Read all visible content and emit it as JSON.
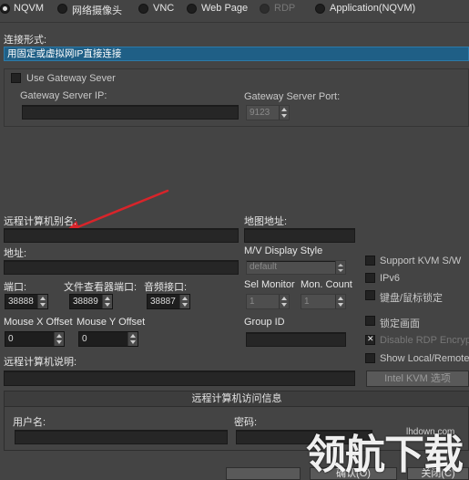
{
  "connection_types": [
    {
      "label": "NQVM",
      "selected": true
    },
    {
      "label": "网络摄像头",
      "selected": false
    },
    {
      "label": "VNC",
      "selected": false
    },
    {
      "label": "Web Page",
      "selected": false
    },
    {
      "label": "RDP",
      "selected": false
    },
    {
      "label": "Application(NQVM)",
      "selected": false
    }
  ],
  "connection_form": {
    "label": "连接形式:",
    "value": "用固定或虚拟网IP直接连接"
  },
  "gateway": {
    "use_label": "Use Gateway Sever",
    "ip_label": "Gateway Server IP:",
    "ip_value": "",
    "port_label": "Gateway Server Port:",
    "port_value": "9123"
  },
  "remote": {
    "alias_label": "远程计算机别名:",
    "alias_value": "",
    "map_label": "地图地址:",
    "map_value": "",
    "address_label": "地址:",
    "address_value": "",
    "mv_style_label": "M/V Display Style",
    "mv_style_value": "default",
    "port_label": "端口:",
    "port_value": "38888",
    "fileviewer_port_label": "文件查看器端口:",
    "fileviewer_port_value": "38889",
    "audio_port_label": "音频接口:",
    "audio_port_value": "38887",
    "sel_monitor_label": "Sel Monitor",
    "sel_monitor_value": "1",
    "mon_count_label": "Mon. Count",
    "mon_count_value": "1",
    "mouse_x_label": "Mouse X Offset",
    "mouse_x_value": "0",
    "mouse_y_label": "Mouse Y Offset",
    "mouse_y_value": "0",
    "group_id_label": "Group ID",
    "group_id_value": "",
    "desc_label": "远程计算机说明:",
    "desc_value": ""
  },
  "options": {
    "support_kvm": "Support KVM S/W",
    "ipv6": "IPv6",
    "lock_kb_mouse": "键盘/鼠标锁定",
    "lock_screen": "锁定画面",
    "disable_rdp": "Disable RDP Encryption",
    "show_local_remote": "Show Local/Remote Info",
    "intel_kvm_button": "Intel KVM 选项"
  },
  "access_info": {
    "title": "远程计算机访问信息",
    "username_label": "用户名:",
    "username_value": "",
    "password_label": "密码:",
    "password_value": ""
  },
  "footer": {
    "ok": "确认(O)",
    "close": "关闭(C)"
  },
  "watermark": {
    "site": "lhdown.com",
    "brand": "领航下载"
  },
  "colors": {
    "background": "#444444",
    "selection": "#1f5f86",
    "arrow": "#d8242a"
  }
}
